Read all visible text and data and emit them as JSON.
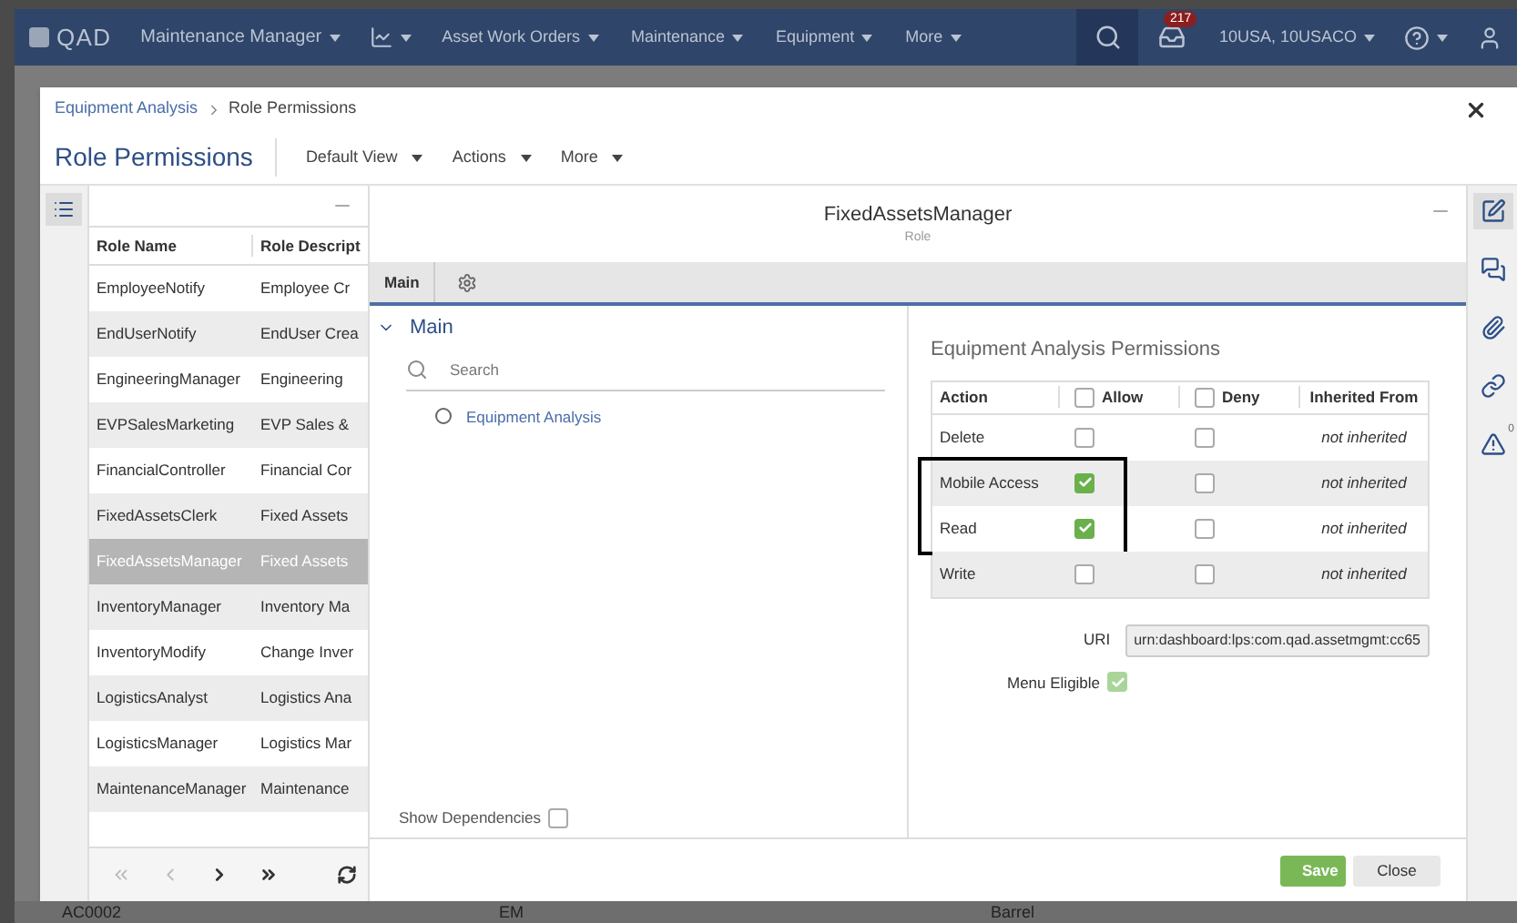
{
  "nav": {
    "logo": "QAD",
    "app": "Maintenance Manager",
    "items": [
      "Asset Work Orders",
      "Maintenance",
      "Equipment",
      "More"
    ],
    "notifications": "217",
    "domain": "10USA, 10USACO"
  },
  "background": {
    "cells": [
      "AC0002",
      "EM",
      "Barrel"
    ]
  },
  "dialog": {
    "breadcrumb": [
      {
        "label": "Equipment Analysis",
        "kind": "link"
      },
      {
        "label": "Role Permissions",
        "kind": "current"
      }
    ],
    "title": "Role Permissions",
    "menus": [
      "Default View",
      "Actions",
      "More"
    ],
    "roles": {
      "columns": [
        "Role Name",
        "Role Descript"
      ],
      "rows": [
        {
          "name": "EmployeeNotify",
          "description": "Employee Cr",
          "selected": false
        },
        {
          "name": "EndUserNotify",
          "description": "EndUser Crea",
          "selected": false
        },
        {
          "name": "EngineeringManager",
          "description": "Engineering",
          "selected": false
        },
        {
          "name": "EVPSalesMarketing",
          "description": "EVP Sales &",
          "selected": false
        },
        {
          "name": "FinancialController",
          "description": "Financial Cor",
          "selected": false
        },
        {
          "name": "FixedAssetsClerk",
          "description": "Fixed Assets",
          "selected": false
        },
        {
          "name": "FixedAssetsManager",
          "description": "Fixed Assets",
          "selected": true
        },
        {
          "name": "InventoryManager",
          "description": "Inventory Ma",
          "selected": false
        },
        {
          "name": "InventoryModify",
          "description": "Change Inver",
          "selected": false
        },
        {
          "name": "LogisticsAnalyst",
          "description": "Logistics Ana",
          "selected": false
        },
        {
          "name": "LogisticsManager",
          "description": "Logistics Mar",
          "selected": false
        },
        {
          "name": "MaintenanceManager",
          "description": "Maintenance",
          "selected": false
        }
      ]
    },
    "detail": {
      "title": "FixedAssetsManager",
      "subtitle": "Role",
      "tabs": [
        {
          "label": "Main",
          "selected": true
        }
      ],
      "section": {
        "title": "Main",
        "expanded": true
      },
      "search": {
        "placeholder": "Search"
      },
      "tree": [
        {
          "label": "Equipment Analysis",
          "selected": false
        }
      ],
      "show_dependencies": {
        "label": "Show Dependencies",
        "checked": false
      },
      "permissions": {
        "title": "Equipment Analysis Permissions",
        "columns": [
          "Action",
          "Allow",
          "Deny",
          "Inherited From"
        ],
        "allow_all": false,
        "deny_all": false,
        "rows": [
          {
            "action": "Delete",
            "allow": false,
            "deny": false,
            "inherited": "not inherited",
            "highlighted": false
          },
          {
            "action": "Mobile Access",
            "allow": true,
            "deny": false,
            "inherited": "not inherited",
            "highlighted": true
          },
          {
            "action": "Read",
            "allow": true,
            "deny": false,
            "inherited": "not inherited",
            "highlighted": true
          },
          {
            "action": "Write",
            "allow": false,
            "deny": false,
            "inherited": "not inherited",
            "highlighted": false
          }
        ]
      },
      "uri": {
        "label": "URI",
        "value": "urn:dashboard:lps:com.qad.assetmgmt:cc65"
      },
      "menu_eligible": {
        "label": "Menu Eligible",
        "checked": true
      }
    },
    "buttons": [
      {
        "label": "Save",
        "kind": "primary"
      },
      {
        "label": "Close",
        "kind": "secondary"
      }
    ],
    "side_tools": [
      {
        "kind": "edit",
        "selected": true
      },
      {
        "kind": "comments",
        "selected": false
      },
      {
        "kind": "attach",
        "selected": false
      },
      {
        "kind": "link",
        "selected": false
      },
      {
        "kind": "alert",
        "selected": false,
        "count": "0"
      }
    ]
  }
}
